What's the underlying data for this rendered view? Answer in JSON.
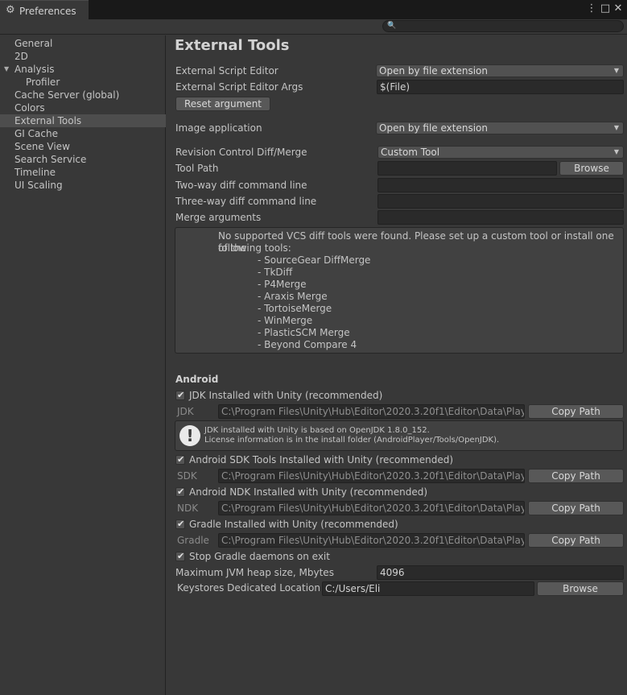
{
  "window": {
    "title": "Preferences",
    "icons": {
      "tab": "gear-icon",
      "menu": "kebab-menu-icon",
      "maximize": "maximize-icon",
      "close": "close-icon"
    }
  },
  "search": {
    "placeholder": ""
  },
  "sidebar": {
    "items": [
      {
        "label": "General",
        "name": "general"
      },
      {
        "label": "2D",
        "name": "2d"
      },
      {
        "label": "Analysis",
        "name": "analysis"
      },
      {
        "label": "Profiler",
        "name": "profiler"
      },
      {
        "label": "Cache Server (global)",
        "name": "cache-server"
      },
      {
        "label": "Colors",
        "name": "colors"
      },
      {
        "label": "External Tools",
        "name": "external-tools",
        "selected": true
      },
      {
        "label": "GI Cache",
        "name": "gi-cache"
      },
      {
        "label": "Scene View",
        "name": "scene-view"
      },
      {
        "label": "Search Service",
        "name": "search-service"
      },
      {
        "label": "Timeline",
        "name": "timeline"
      },
      {
        "label": "UI Scaling",
        "name": "ui-scaling"
      }
    ]
  },
  "main": {
    "title": "External Tools",
    "script_editor": {
      "label": "External Script Editor",
      "value": "Open by file extension"
    },
    "script_editor_args": {
      "label": "External Script Editor Args",
      "value": "$(File)"
    },
    "reset_argument": "Reset argument",
    "image_app": {
      "label": "Image application",
      "value": "Open by file extension"
    },
    "revision_control": {
      "label": "Revision Control Diff/Merge",
      "value": "Custom Tool"
    },
    "tool_path": {
      "label": "Tool Path",
      "value": "",
      "button": "Browse"
    },
    "two_way": {
      "label": "Two-way diff command line",
      "value": ""
    },
    "three_way": {
      "label": "Three-way diff command line",
      "value": ""
    },
    "merge_args": {
      "label": "Merge arguments",
      "value": ""
    },
    "vcs_help": {
      "line1": "No supported VCS diff tools were found. Please set up a custom tool or install one of the",
      "line2": "following tools:",
      "tools": [
        "- SourceGear DiffMerge",
        "- TkDiff",
        "- P4Merge",
        "- Araxis Merge",
        "- TortoiseMerge",
        "- WinMerge",
        "- PlasticSCM Merge",
        "- Beyond Compare 4"
      ]
    },
    "android": {
      "heading": "Android",
      "jdk_check": "JDK Installed with Unity (recommended)",
      "jdk_label": "JDK",
      "jdk_path": "C:\\Program Files\\Unity\\Hub\\Editor\\2020.3.20f1\\Editor\\Data\\PlaybackEngines",
      "copy_path": "Copy Path",
      "jdk_info_line1": "JDK installed with Unity is based on OpenJDK 1.8.0_152.",
      "jdk_info_line2": "License information is in the install folder (AndroidPlayer/Tools/OpenJDK).",
      "sdk_check": "Android SDK Tools Installed with Unity (recommended)",
      "sdk_label": "SDK",
      "sdk_path": "C:\\Program Files\\Unity\\Hub\\Editor\\2020.3.20f1\\Editor\\Data\\PlaybackEngines",
      "ndk_check": "Android NDK Installed with Unity (recommended)",
      "ndk_label": "NDK",
      "ndk_path": "C:\\Program Files\\Unity\\Hub\\Editor\\2020.3.20f1\\Editor\\Data\\PlaybackEngines",
      "gradle_check": "Gradle Installed with Unity (recommended)",
      "gradle_label": "Gradle",
      "gradle_path": "C:\\Program Files\\Unity\\Hub\\Editor\\2020.3.20f1\\Editor\\Data\\PlaybackEngines",
      "stop_daemons": "Stop Gradle daemons on exit",
      "jvm_heap": {
        "label": "Maximum JVM heap size, Mbytes",
        "value": "4096"
      },
      "keystores": {
        "label": "Keystores Dedicated Location",
        "value": "C:/Users/Eli",
        "button": "Browse"
      }
    }
  }
}
